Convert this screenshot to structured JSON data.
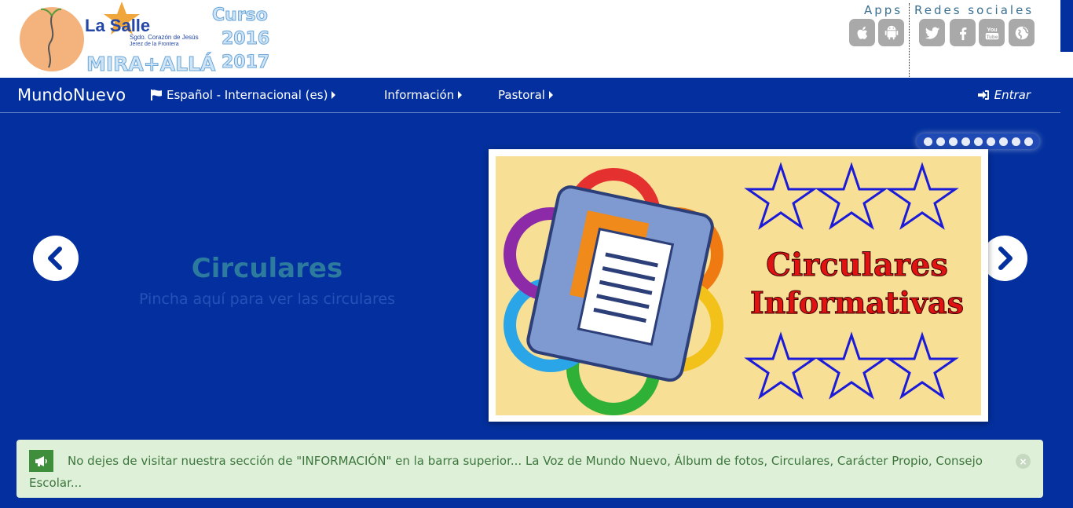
{
  "header": {
    "logo_brand": "La Salle",
    "logo_school": "Sgdo. Corazón de Jesús",
    "logo_city": "Jerez de la Frontera",
    "logo_motto": "MIRA+ALLÁ",
    "logo_curso": "Curso",
    "logo_year1": "2016",
    "logo_year2": "2017",
    "apps_label": "Apps",
    "social_label": "Redes sociales",
    "app_icons": [
      "apple-icon",
      "android-icon"
    ],
    "social_icons": [
      "twitter-icon",
      "facebook-icon",
      "youtube-icon",
      "globe-icon"
    ]
  },
  "nav": {
    "brand": "MundoNuevo",
    "language": "Español - Internacional (es)",
    "informacion": "Información",
    "pastoral": "Pastoral",
    "login": "Entrar"
  },
  "slider": {
    "title": "Circulares",
    "subtitle": "Pincha aquí para ver las circulares",
    "image_text_line1": "Circulares",
    "image_text_line2": "Informativas",
    "dot_count": 9
  },
  "alert": {
    "text": "No dejes de visitar nuestra sección de \"INFORMACIÓN\" en la barra superior... La Voz de Mundo Nuevo, Álbum de fotos, Circulares, Carácter Propio, Consejo Escolar...",
    "close": "×"
  },
  "colors": {
    "primary": "#03309e",
    "alert_bg": "#dff0d8",
    "alert_text": "#3c763d",
    "icon_grey": "#a9a9a9"
  }
}
